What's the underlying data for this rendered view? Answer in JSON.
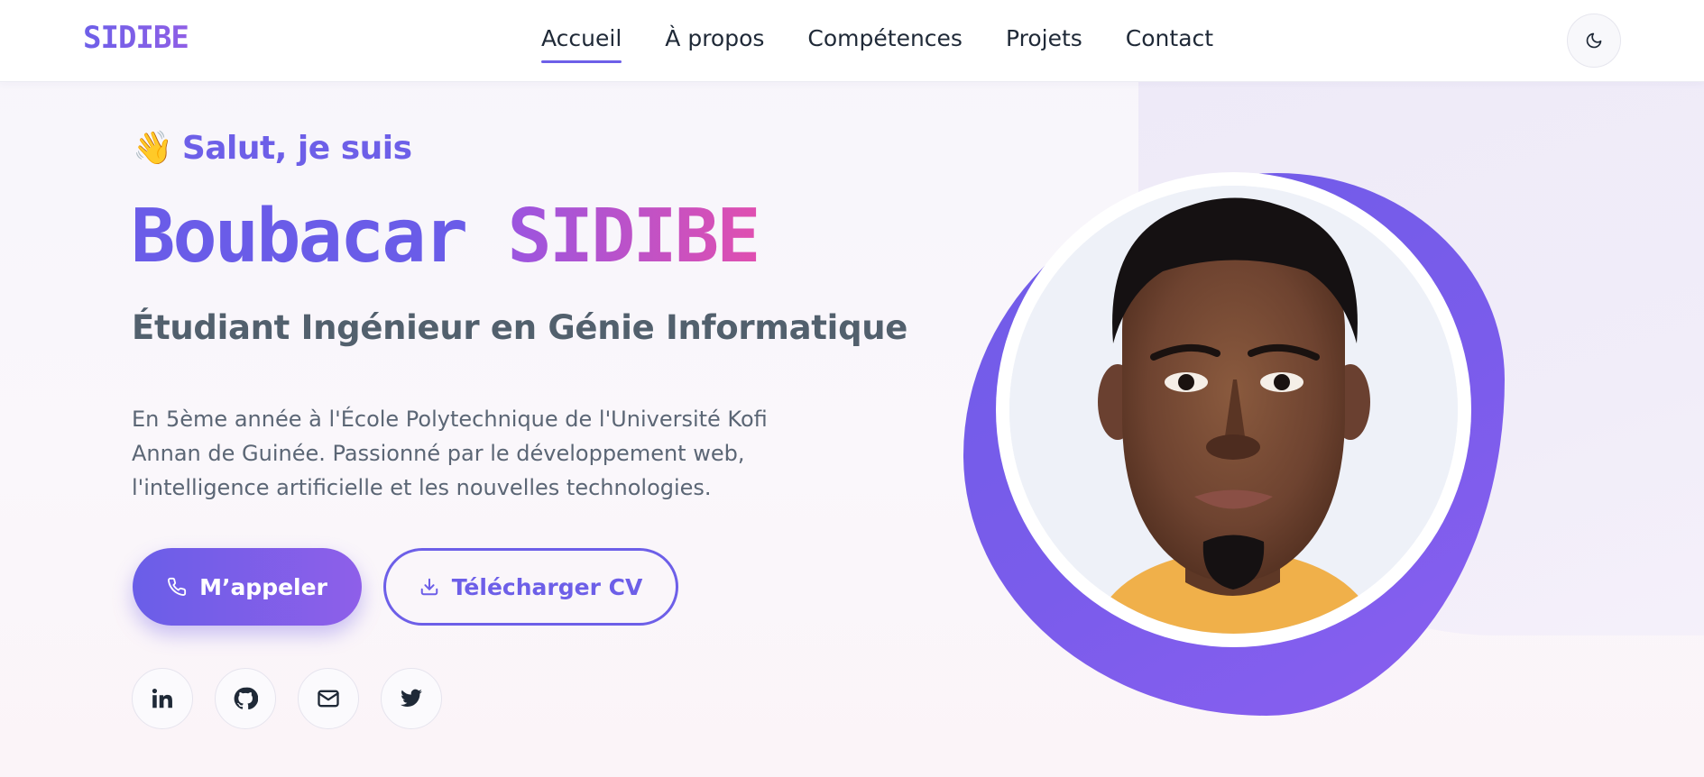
{
  "header": {
    "brand": "SIDIBE",
    "nav": [
      {
        "label": "Accueil",
        "active": true
      },
      {
        "label": "À propos",
        "active": false
      },
      {
        "label": "Compétences",
        "active": false
      },
      {
        "label": "Projets",
        "active": false
      },
      {
        "label": "Contact",
        "active": false
      }
    ],
    "theme_toggle_icon": "moon-icon"
  },
  "hero": {
    "greeting_emoji": "👋",
    "greeting": "Salut, je suis",
    "first_name": "Boubacar",
    "last_name": "SIDIBE",
    "role": "Étudiant Ingénieur en Génie Informatique",
    "description": "En 5ème année à l'École Polytechnique de l'Université Kofi Annan de Guinée. Passionné par le développement web, l'intelligence artificielle et les nouvelles technologies.",
    "call_button": "M’appeler",
    "cv_button": "Télécharger CV",
    "socials": [
      "linkedin-icon",
      "github-icon",
      "mail-icon",
      "twitter-icon"
    ]
  },
  "colors": {
    "accent": "#6d5fe8",
    "accent_end": "#8e5fe9",
    "pink": "#e04fb0",
    "text_muted": "#5b6675"
  }
}
